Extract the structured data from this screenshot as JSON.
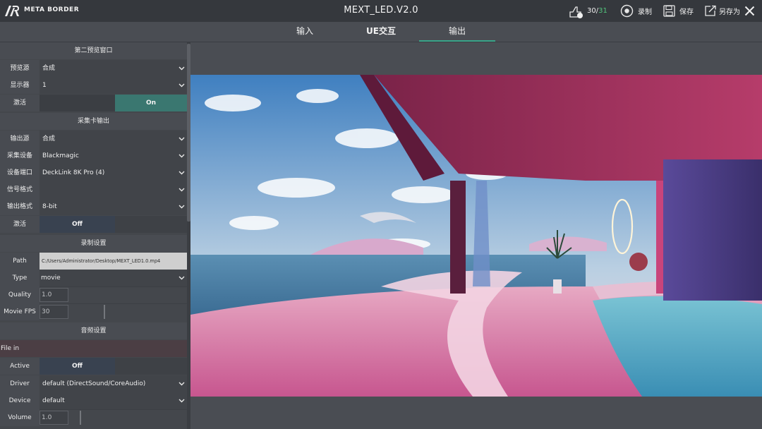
{
  "titlebar": {
    "brand": "META BORDER",
    "title": "MEXT_LED.V2.0",
    "counter_current": "30/",
    "counter_total": "31",
    "record_label": "录制",
    "save_label": "保存",
    "save_as_label": "另存为"
  },
  "tabs": [
    {
      "label": "输入"
    },
    {
      "label": "UE交互"
    },
    {
      "label": "输出"
    }
  ],
  "preview2": {
    "header": "第二预览窗口",
    "source_label": "预览源",
    "source_value": "合成",
    "display_label": "显示器",
    "display_value": "1",
    "activate_label": "激活",
    "activate_state": "On"
  },
  "capture_output": {
    "header": "采集卡输出",
    "output_source_label": "输出源",
    "output_source_value": "合成",
    "device_label": "采集设备",
    "device_value": "Blackmagic",
    "port_label": "设备端口",
    "port_value": "DeckLink 8K Pro (4)",
    "signal_label": "信号格式",
    "signal_value": "",
    "format_label": "输出格式",
    "format_value": "8-bit",
    "activate_label": "激活",
    "activate_state": "Off"
  },
  "record_settings": {
    "header": "录制设置",
    "path_label": "Path",
    "path_value": "C:/Users/Administrator/Desktop/MEXT_LED1.0.mp4",
    "type_label": "Type",
    "type_value": "movie",
    "quality_label": "Quality",
    "quality_value": "1.0",
    "fps_label": "Movie FPS",
    "fps_value": "30"
  },
  "audio_settings": {
    "header": "音频设置",
    "file_in_label": "File in",
    "active_label": "Active",
    "active_state": "Off",
    "driver_label": "Driver",
    "driver_value": "default (DirectSound/CoreAudio)",
    "device_label": "Device",
    "device_value": "default",
    "volume_label": "Volume",
    "volume_value": "1.0"
  },
  "colors": {
    "accent": "#3aa58a",
    "counter_total": "#52c47c",
    "toggle_on": "#3a7770",
    "toggle_off": "#394250"
  },
  "icons": [
    "logo-icon",
    "scene-count-icon",
    "record-icon",
    "save-icon",
    "save-as-icon",
    "close-icon",
    "chevron-down-icon"
  ]
}
